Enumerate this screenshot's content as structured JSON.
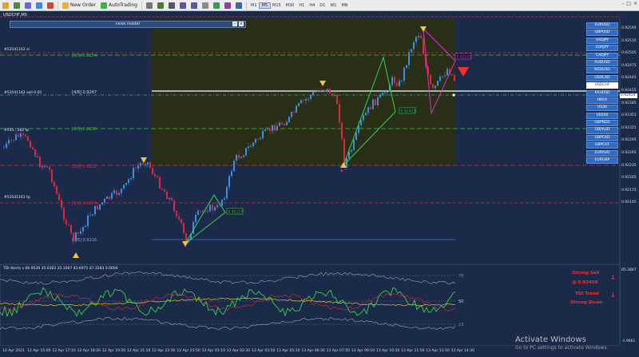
{
  "toolbar": {
    "new_order": "New Order",
    "autotrading": "AutoTrading",
    "timeframes": [
      "M1",
      "M5",
      "M15",
      "M30",
      "H1",
      "H4",
      "D1",
      "W1",
      "MN"
    ],
    "active_timeframe": "M5"
  },
  "chart": {
    "symbol_title": "USDCHF,M5",
    "news_title": "news reader",
    "levels_left": [
      {
        "label": "#53541162 sl"
      },
      {
        "label": "#53541162 sell 0.05"
      },
      {
        "label": "#535...162 tp"
      },
      {
        "label": "#53541161 tp"
      }
    ],
    "fib_labels": [
      {
        "pct": "[5/8]",
        "price": "0.9254"
      },
      {
        "pct": "[4/8]",
        "price": "0.9247"
      },
      {
        "pct": "[3/8]",
        "price": "0.9239"
      },
      {
        "pct": "[2/8]",
        "price": "0.9232"
      },
      {
        "pct": "[1/8]",
        "price": "0.9224"
      },
      {
        "pct": "[0/8]",
        "price": "0.9216"
      }
    ],
    "boxed_prices": [
      "0.92217",
      "0.92423",
      "0.92535"
    ],
    "price_axis": [
      "0.92595",
      "0.92535",
      "0.92505",
      "0.92475",
      "0.92445",
      "0.92415",
      "0.92385",
      "0.92355",
      "0.92325",
      "0.92295",
      "0.92265",
      "0.92235",
      "0.92205",
      "0.92175",
      "0.92145"
    ],
    "current_price": "0.92454",
    "time_axis": [
      "12 Apr 2021",
      "12 Apr 15:00",
      "12 Apr 17:10",
      "12 Apr 18:20",
      "12 Apr 19:50",
      "12 Apr 21:10",
      "12 Apr 22:30",
      "12 Apr 23:50",
      "13 Apr 01:10",
      "13 Apr 02:30",
      "13 Apr 03:50",
      "13 Apr 05:10",
      "13 Apr 06:30",
      "13 Apr 07:50",
      "13 Apr 09:10",
      "13 Apr 10:30",
      "13 Apr 11:50",
      "13 Apr 13:10",
      "13 Apr 14:30"
    ]
  },
  "symbols": [
    "EURUSD",
    "GBPUSD",
    "USDJPY",
    "EURJPY",
    "CADJPY",
    "AUDUSD",
    "NZDUSD",
    "USDCAD",
    "USDCHF",
    "XAUUSD",
    "HKEX",
    "US30",
    "US500",
    "GBPNZD",
    "GBPAUD",
    "GBPCAD",
    "GBPCHF",
    "EURAUD",
    "EURGBP"
  ],
  "active_symbol": "USDCHF",
  "tdi": {
    "title": "TDI Alerts v 66.9539 35.0303 35.1067 43.6975 47.3283 0.0000",
    "axis": [
      "78",
      "50",
      "23"
    ],
    "top_value": "85.3887",
    "bottom_value": "-1.9661",
    "signal": {
      "line1": "Strong Sell",
      "line2": "@ 0.92458",
      "line3": "TDI Trend",
      "line4": "Strong Down"
    }
  },
  "watermark": {
    "title": "Activate Windows",
    "subtitle": "Go to PC settings to activate Windows."
  },
  "colors": {
    "background": "#1b2a48",
    "bull": "#3d8fe6",
    "bear": "#e0283c",
    "zone": "#2a2f14"
  }
}
